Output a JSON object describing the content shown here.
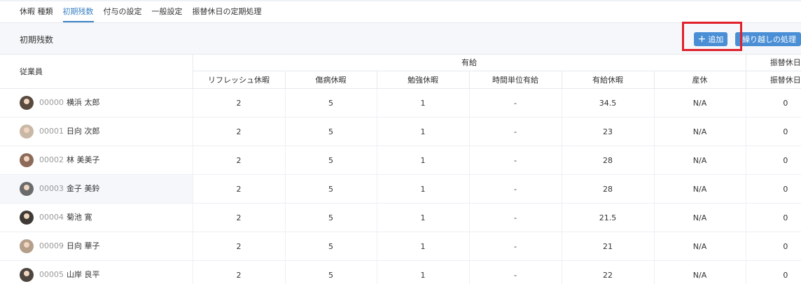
{
  "tabs": [
    "休暇 種類",
    "初期残数",
    "付与の設定",
    "一般設定",
    "振替休日の定期処理"
  ],
  "active_tab_index": 1,
  "page": {
    "title": "初期残数",
    "add_button": "追加",
    "carry_button": "繰り越しの処理"
  },
  "table": {
    "employee_header": "従業員",
    "group_headers": [
      "有給",
      "振替休日"
    ],
    "columns": [
      "リフレッシュ休暇",
      "傷病休暇",
      "勉強休暇",
      "時間単位有給",
      "有給休暇",
      "産休",
      "振替休日"
    ],
    "rows": [
      {
        "id": "00000",
        "name": "横浜 太郎",
        "values": [
          "2",
          "5",
          "1",
          "-",
          "34.5",
          "N/A",
          "0"
        ]
      },
      {
        "id": "00001",
        "name": "日向 次郎",
        "values": [
          "2",
          "5",
          "1",
          "-",
          "23",
          "N/A",
          "0"
        ]
      },
      {
        "id": "00002",
        "name": "林 美美子",
        "values": [
          "2",
          "5",
          "1",
          "-",
          "28",
          "N/A",
          "0"
        ]
      },
      {
        "id": "00003",
        "name": "金子 美鈴",
        "values": [
          "2",
          "5",
          "1",
          "-",
          "28",
          "N/A",
          "0"
        ]
      },
      {
        "id": "00004",
        "name": "菊池 寛",
        "values": [
          "2",
          "5",
          "1",
          "-",
          "21.5",
          "N/A",
          "0"
        ]
      },
      {
        "id": "00009",
        "name": "日向 華子",
        "values": [
          "2",
          "5",
          "1",
          "-",
          "21",
          "N/A",
          "0"
        ]
      },
      {
        "id": "00005",
        "name": "山岸 良平",
        "values": [
          "2",
          "5",
          "1",
          "-",
          "22",
          "N/A",
          "0"
        ]
      }
    ]
  },
  "colors": {
    "accent": "#3b82c4",
    "button": "#4a8fd6",
    "highlight": "#e0202a"
  }
}
